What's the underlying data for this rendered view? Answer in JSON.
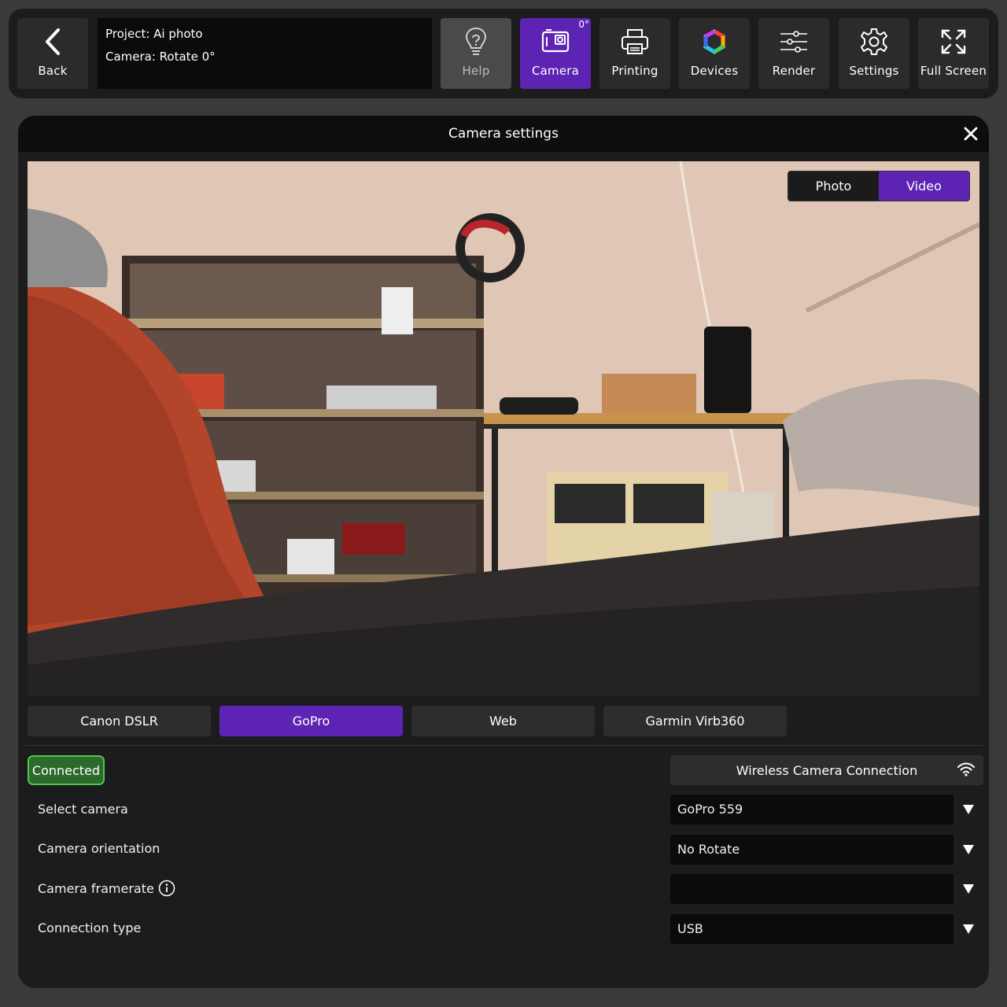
{
  "toolbar": {
    "back_label": "Back",
    "project_line": "Project: Ai photo",
    "camera_line": "Camera: Rotate 0°",
    "help_label": "Help",
    "camera_label": "Camera",
    "camera_badge": "0°",
    "printing_label": "Printing",
    "devices_label": "Devices",
    "render_label": "Render",
    "settings_label": "Settings",
    "fullscreen_label": "Full Screen"
  },
  "panel": {
    "title": "Camera settings",
    "mode_toggle": {
      "photo_label": "Photo",
      "video_label": "Video",
      "selected": "Video"
    },
    "camera_tabs": [
      {
        "label": "Canon DSLR",
        "active": false
      },
      {
        "label": "GoPro",
        "active": true
      },
      {
        "label": "Web",
        "active": false
      },
      {
        "label": "Garmin Virb360",
        "active": false
      }
    ],
    "status": "Connected",
    "wireless_label": "Wireless Camera Connection",
    "rows": [
      {
        "label": "Select camera",
        "value": "GoPro 559"
      },
      {
        "label": "Camera orientation",
        "value": "No Rotate"
      },
      {
        "label": "Camera framerate",
        "value": ""
      },
      {
        "label": "Connection type",
        "value": "USB"
      }
    ]
  },
  "colors": {
    "accent": "#5d23b3",
    "connected_bg": "#2c6a2b",
    "connected_border": "#55c451",
    "panel_bg": "#1c1c1c"
  },
  "icons": [
    "chevron-left-icon",
    "lightbulb-icon",
    "camera-icon",
    "printer-icon",
    "devices-ring-icon",
    "sliders-icon",
    "gear-icon",
    "fullscreen-icon",
    "close-icon",
    "wifi-icon",
    "info-icon",
    "dropdown-arrow-icon"
  ]
}
